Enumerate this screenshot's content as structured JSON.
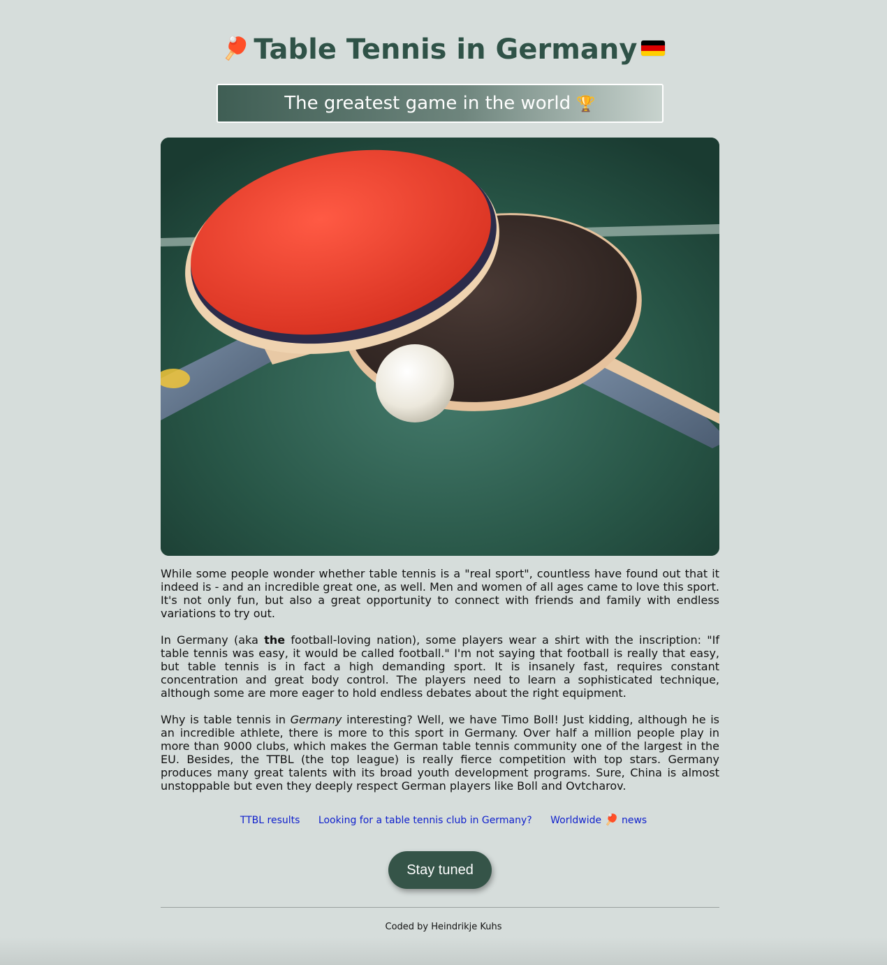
{
  "header": {
    "title": "Table Tennis in Germany",
    "title_icon": "ping-pong-paddle-icon",
    "flag_icon": "germany-flag-icon",
    "flag_colors": [
      "#000000",
      "#dd0000",
      "#ffce00"
    ],
    "subtitle": "The greatest game in the world",
    "subtitle_icon": "trophy-icon"
  },
  "hero_image": {
    "alt": "Table tennis paddles and ball",
    "icon": "paddles-and-ball-photo"
  },
  "article": {
    "p1": "While some people wonder whether table tennis is a \"real sport\", countless have found out that it indeed is - and an incredible great one, as well. Men and women of all ages came to love this sport. It's not only fun, but also a great opportunity to connect with friends and family with endless variations to try out.",
    "p2_before": "In Germany (aka ",
    "p2_bold": "the",
    "p2_after": " football-loving nation), some players wear a shirt with the inscription: \"If table tennis was easy, it would be called football.\" I'm not saying that football is really that easy, but table tennis is in fact a high demanding sport. It is insanely fast, requires constant concentration and great body control. The players need to learn a sophisticated technique, although some are more eager to hold endless debates about the right equipment.",
    "p3_before": "Why is table tennis in ",
    "p3_italic": "Germany",
    "p3_after": " interesting? Well, we have Timo Boll! Just kidding, although he is an incredible athlete, there is more to this sport in Germany. Over half a million people play in more than 9000 clubs, which makes the German table tennis community one of the largest in the EU. Besides, the TTBL (the top league) is really fierce competition with top stars. Germany produces many great talents with its broad youth development programs. Sure, China is almost unstoppable but even they deeply respect German players like Boll and Ovtcharov."
  },
  "links": {
    "ttbl": "TTBL results",
    "club": "Looking for a table tennis club in Germany?",
    "news_before": "Worldwide",
    "news_icon": "ping-pong-paddle-icon",
    "news_after": "news"
  },
  "cta": {
    "label": "Stay tuned"
  },
  "footer": {
    "text": "Coded by Heindrikje Kuhs"
  },
  "colors": {
    "background": "#d6dddb",
    "title": "#2f5247",
    "button": "#355448",
    "link": "#0e1fcc"
  }
}
